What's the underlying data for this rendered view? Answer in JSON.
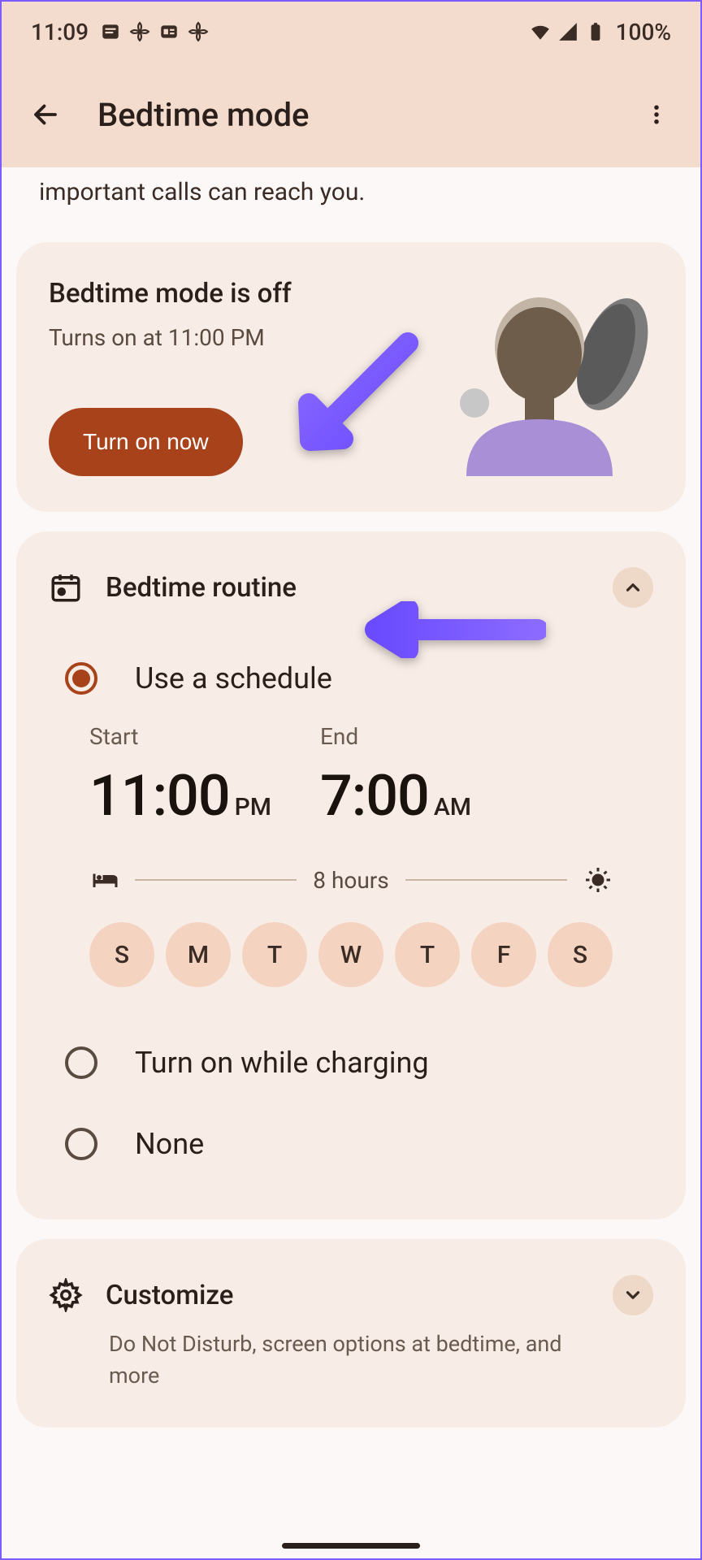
{
  "status_bar": {
    "time": "11:09",
    "battery_pct": "100%"
  },
  "app_bar": {
    "title": "Bedtime mode"
  },
  "description_fragment": "important calls can reach you.",
  "status_card": {
    "title": "Bedtime mode is off",
    "subtitle": "Turns on at 11:00 PM",
    "button_label": "Turn on now"
  },
  "routine": {
    "title": "Bedtime routine",
    "options": {
      "schedule": "Use a schedule",
      "charging": "Turn on while charging",
      "none": "None"
    },
    "schedule": {
      "start_label": "Start",
      "start_time": "11:00",
      "start_ampm": "PM",
      "end_label": "End",
      "end_time": "7:00",
      "end_ampm": "AM",
      "duration": "8 hours",
      "days": [
        "S",
        "M",
        "T",
        "W",
        "T",
        "F",
        "S"
      ]
    }
  },
  "customize": {
    "title": "Customize",
    "subtitle": "Do Not Disturb, screen options at bedtime, and more"
  },
  "colors": {
    "accent": "#a8421a",
    "card_bg": "#f8ece6",
    "header_bg": "#f3dcce",
    "chip_bg": "#f4d3c1",
    "arrow": "#7c5cff"
  }
}
